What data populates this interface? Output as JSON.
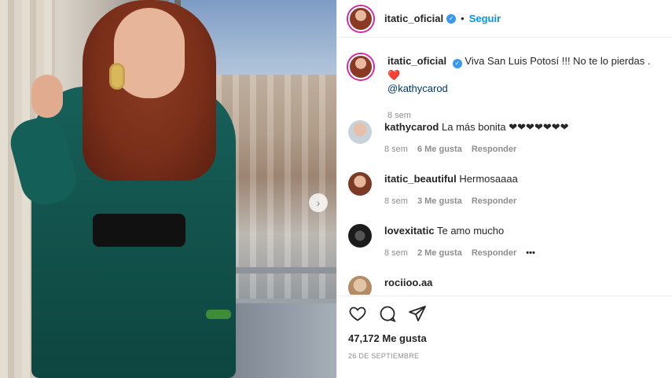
{
  "post": {
    "username": "itatic_oficial",
    "follow_label": "Seguir",
    "caption_user": "itatic_oficial",
    "caption_text": "Viva San Luis Potosí !!! No te lo pierdas . ❤️",
    "caption_mention": "@kathycarod",
    "caption_time": "8 sem"
  },
  "comments": [
    {
      "user": "kathycarod",
      "text": "La más bonita ❤❤❤❤❤❤❤",
      "time": "8 sem",
      "likes": "6 Me gusta",
      "reply": "Responder"
    },
    {
      "user": "itatic_beautiful",
      "text": "Hermosaaaa",
      "time": "8 sem",
      "likes": "3 Me gusta",
      "reply": "Responder"
    },
    {
      "user": "lovexitatic",
      "text": "Te amo mucho",
      "time": "8 sem",
      "likes": "2 Me gusta",
      "reply": "Responder",
      "more": "•••"
    },
    {
      "user": "rociioo.aa",
      "text": ""
    }
  ],
  "footer": {
    "likes": "47,172 Me gusta",
    "date": "26 DE SEPTIEMBRE"
  },
  "icons": {
    "like": "heart-icon",
    "comment": "comment-icon",
    "share": "share-icon",
    "next": "chevron-right-icon",
    "verified": "verified-icon"
  },
  "colors": {
    "accent": "#0095f6",
    "verified": "#3897f0",
    "muted": "#8e8e8e"
  }
}
